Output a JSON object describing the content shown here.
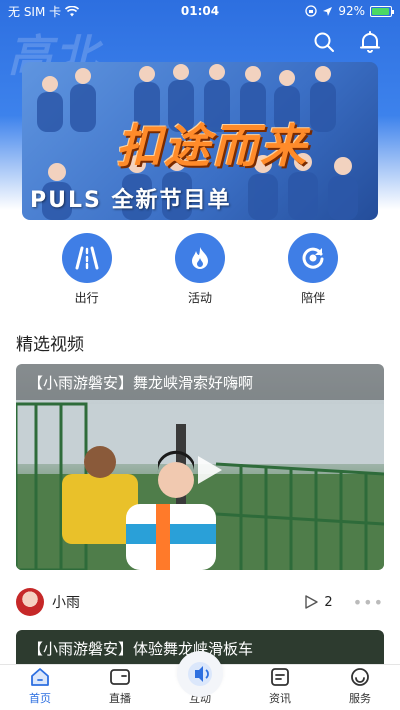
{
  "status_bar": {
    "carrier": "无 SIM 卡",
    "time": "01:04",
    "battery": "92%",
    "battery_level": 0.92
  },
  "header": {
    "watermark": "高北"
  },
  "banner": {
    "title_art": "扣途而来",
    "logo_text": "PULS",
    "caption": "PULS 全新节目单"
  },
  "quick_actions": [
    {
      "label": "出行",
      "icon": "road-icon"
    },
    {
      "label": "活动",
      "icon": "flame-icon"
    },
    {
      "label": "陪伴",
      "icon": "refresh-ring-icon"
    }
  ],
  "section": {
    "title": "精选视频"
  },
  "videos": [
    {
      "title": "【小雨游磐安】舞龙峡滑索好嗨啊",
      "author": "小雨",
      "plays": "2"
    },
    {
      "title": "【小雨游磐安】体验舞龙峡滑板车"
    }
  ],
  "tabs": [
    {
      "label": "首页",
      "icon": "home-icon"
    },
    {
      "label": "直播",
      "icon": "live-tv-icon"
    },
    {
      "label": "互动",
      "icon": "broadcast-icon"
    },
    {
      "label": "资讯",
      "icon": "news-icon"
    },
    {
      "label": "服务",
      "icon": "service-icon"
    }
  ],
  "colors": {
    "accent": "#2d6fe0",
    "action_circle": "#3f7ee6"
  }
}
